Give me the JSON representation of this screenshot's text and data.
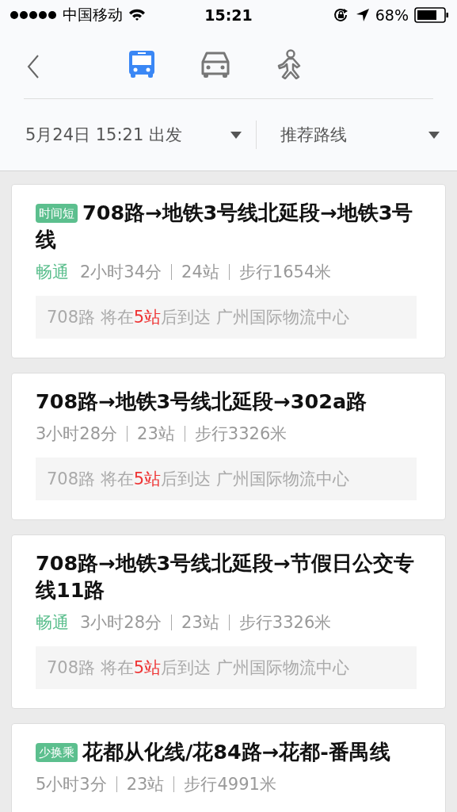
{
  "status_bar": {
    "carrier": "中国移动",
    "time": "15:21",
    "battery": "68%"
  },
  "modes": [
    {
      "kind": "bus",
      "selected": true
    },
    {
      "kind": "car",
      "selected": false
    },
    {
      "kind": "walk",
      "selected": false
    }
  ],
  "filters": {
    "departure": "5月24日 15:21 出发",
    "sort": "推荐路线"
  },
  "routes": [
    {
      "tag": "时间短",
      "title": "708路→地铁3号线北延段→地铁3号线",
      "traffic": "畅通",
      "stats": [
        "2小时34分",
        "24站",
        "步行1654米"
      ],
      "notice": {
        "before": "708路 将在",
        "highlight": "5站",
        "after": "后到达 广州国际物流中心"
      }
    },
    {
      "title": "708路→地铁3号线北延段→302a路",
      "stats": [
        "3小时28分",
        "23站",
        "步行3326米"
      ],
      "notice": {
        "before": "708路 将在",
        "highlight": "5站",
        "after": "后到达 广州国际物流中心"
      }
    },
    {
      "title": "708路→地铁3号线北延段→节假日公交专线11路",
      "traffic": "畅通",
      "stats": [
        "3小时28分",
        "23站",
        "步行3326米"
      ],
      "notice": {
        "before": "708路 将在",
        "highlight": "5站",
        "after": "后到达 广州国际物流中心"
      }
    },
    {
      "tag": "少换乘",
      "title": "花都从化线/花84路→花都-番禺线",
      "stats": [
        "5小时3分",
        "23站",
        "步行4991米"
      ]
    }
  ]
}
